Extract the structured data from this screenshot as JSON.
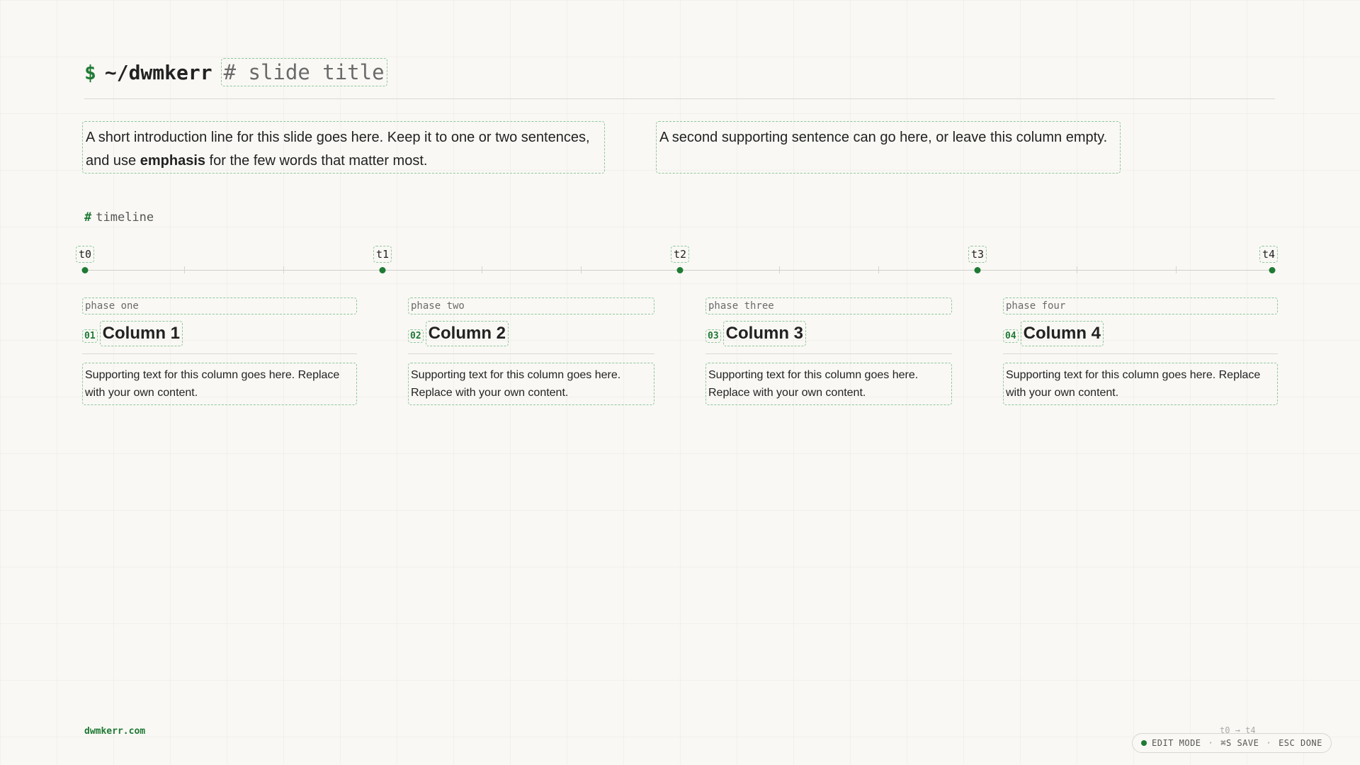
{
  "header": {
    "prompt": "$",
    "path": "~/dwmkerr",
    "slide_title": "# slide title"
  },
  "intro": {
    "left_before": "A short introduction line for this slide goes here. Keep it to one or two sentences, and use ",
    "left_emphasis": "emphasis",
    "left_after": " for the few words that matter most.",
    "right": "A second supporting sentence can go here, or leave this column empty."
  },
  "section": {
    "hash": "#",
    "label": "timeline"
  },
  "timeline": {
    "markers": [
      "t0",
      "t1",
      "t2",
      "t3",
      "t4"
    ]
  },
  "columns": [
    {
      "phase": "phase one",
      "number": "01",
      "title": "Column 1",
      "body": "Supporting text for this column goes here. Replace with your own content."
    },
    {
      "phase": "phase two",
      "number": "02",
      "title": "Column 2",
      "body": "Supporting text for this column goes here. Replace with your own content."
    },
    {
      "phase": "phase three",
      "number": "03",
      "title": "Column 3",
      "body": "Supporting text for this column goes here. Replace with your own content."
    },
    {
      "phase": "phase four",
      "number": "04",
      "title": "Column 4",
      "body": "Supporting text for this column goes here. Replace with your own content."
    }
  ],
  "footer": {
    "domain": "dwmkerr.com",
    "range": "t0 → t4",
    "status": {
      "mode": "EDIT MODE",
      "save": "⌘S SAVE",
      "done": "ESC DONE",
      "separator": "·"
    }
  },
  "colors": {
    "accent": "#1f7a35",
    "background": "#f9f8f4",
    "edit_border": "#8fc79c"
  }
}
